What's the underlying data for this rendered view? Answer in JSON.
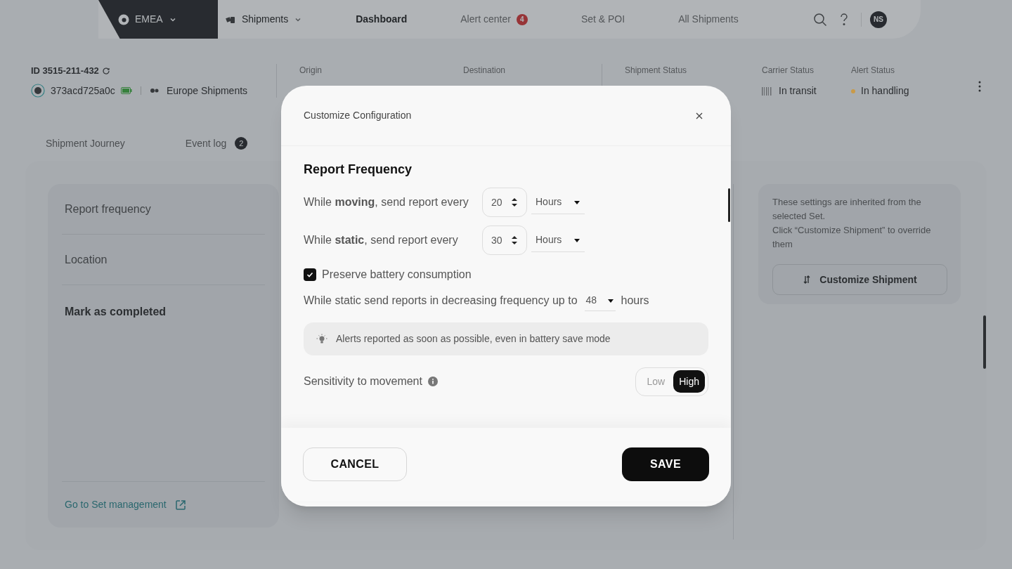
{
  "nav": {
    "region": "EMEA",
    "items": [
      {
        "label": "Shipments",
        "selected": false,
        "dropdown": true
      },
      {
        "label": "Dashboard",
        "selected": true
      },
      {
        "label": "Alert center",
        "selected": false,
        "badge": "4"
      },
      {
        "label": "Set & POI",
        "selected": false
      },
      {
        "label": "All Shipments",
        "selected": false
      }
    ],
    "avatar": "NS"
  },
  "shipment": {
    "id": "ID 3515-211-432",
    "device": "373acd725a0c",
    "set": "Europe Shipments",
    "fields": [
      {
        "label": "Origin"
      },
      {
        "label": "Destination"
      },
      {
        "label": "Shipment Status"
      },
      {
        "label": "Carrier Status",
        "value": "In transit",
        "kind": "carrier"
      },
      {
        "label": "Alert Status",
        "value": "In handling",
        "kind": "dot",
        "color": "#c99a48"
      }
    ]
  },
  "tabs": [
    {
      "label": "Shipment Journey",
      "selected": false
    },
    {
      "label": "Event log",
      "selected": false,
      "badge": "2"
    }
  ],
  "sidebar": {
    "items": [
      {
        "label": "Report frequency",
        "kind": "item"
      },
      {
        "label": "Location",
        "kind": "item"
      },
      {
        "label": "Mark as completed",
        "kind": "heading"
      }
    ],
    "link": "Go to Set management"
  },
  "info": {
    "lines": [
      "These settings are inherited from the selected Set.",
      "Click “Customize Shipment” to override them"
    ],
    "button": "Customize Shipment"
  },
  "modal": {
    "title": "Customize Configuration",
    "section": "Report Frequency",
    "rows": [
      {
        "kind": "interval",
        "text": "While **moving**, send report every",
        "value": "20",
        "unit": "Hours"
      },
      {
        "kind": "interval",
        "text": "While **static**, send report every",
        "value": "30",
        "unit": "Hours"
      },
      {
        "kind": "checkbox",
        "text": "Preserve battery consumption",
        "checked": true
      },
      {
        "kind": "decreasing",
        "text": "While static send reports in decreasing frequency up to",
        "value": "48",
        "unit": "hours"
      },
      {
        "kind": "note",
        "text": "Alerts reported as soon as possible, even in battery save mode"
      },
      {
        "kind": "toggle",
        "text": "Sensitivity to movement",
        "options": [
          {
            "label": "Low",
            "selected": false
          },
          {
            "label": "High",
            "selected": true
          }
        ]
      }
    ],
    "buttons": [
      {
        "label": "CANCEL",
        "kind": "secondary"
      },
      {
        "label": "SAVE",
        "kind": "primary"
      }
    ]
  }
}
